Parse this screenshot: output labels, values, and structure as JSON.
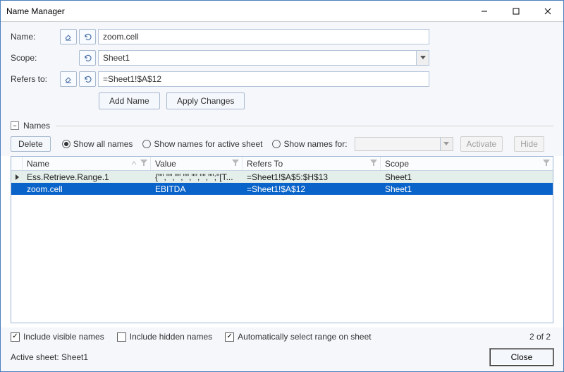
{
  "window": {
    "title": "Name Manager"
  },
  "form": {
    "name_label": "Name:",
    "name_value": "zoom.cell",
    "scope_label": "Scope:",
    "scope_value": "Sheet1",
    "refers_label": "Refers to:",
    "refers_value": "=Sheet1!$A$12",
    "add_name_btn": "Add Name",
    "apply_changes_btn": "Apply Changes"
  },
  "section": {
    "collapse_symbol": "−",
    "names_label": "Names"
  },
  "toolbar": {
    "delete_btn": "Delete",
    "radio_all": "Show all names",
    "radio_active": "Show names for active sheet",
    "radio_for": "Show names for:",
    "activate_btn": "Activate",
    "hide_btn": "Hide"
  },
  "grid": {
    "headers": {
      "name": "Name",
      "value": "Value",
      "refers": "Refers To",
      "scope": "Scope"
    },
    "rows": [
      {
        "name": "Ess.Retrieve.Range.1",
        "value": "{\"\",\"\",\"\",\"\",\"\",\"\",\"\";\"[T...",
        "refers": "=Sheet1!$A$5:$H$13",
        "scope": "Sheet1"
      },
      {
        "name": "zoom.cell",
        "value": "EBITDA",
        "refers": "=Sheet1!$A$12",
        "scope": "Sheet1"
      }
    ]
  },
  "footer": {
    "include_visible": "Include visible names",
    "include_hidden": "Include hidden names",
    "auto_select": "Automatically select range on sheet",
    "count": "2 of 2",
    "active_sheet_label": "Active sheet:  Sheet1",
    "close_btn": "Close"
  }
}
